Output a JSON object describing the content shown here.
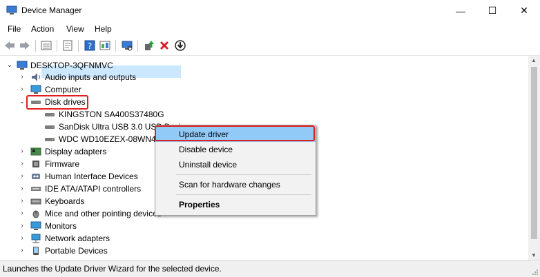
{
  "window": {
    "title": "Device Manager",
    "minimize": "—",
    "maximize": "☐",
    "close": "✕"
  },
  "menu": [
    "File",
    "Action",
    "View",
    "Help"
  ],
  "tree": {
    "root": "DESKTOP-3QFNMVC",
    "items": [
      {
        "label": "Audio inputs and outputs",
        "icon": "speaker-icon"
      },
      {
        "label": "Computer",
        "icon": "monitor-icon"
      },
      {
        "label": "Disk drives",
        "icon": "drive-icon"
      },
      {
        "label": "KINGSTON SA400S37480G",
        "icon": "drive-icon"
      },
      {
        "label": "SanDisk Ultra USB 3.0 USB Device",
        "icon": "drive-icon"
      },
      {
        "label": "WDC WD10EZEX-08WN4A0",
        "icon": "drive-icon"
      },
      {
        "label": "Display adapters",
        "icon": "display-adapter-icon"
      },
      {
        "label": "Firmware",
        "icon": "firmware-icon"
      },
      {
        "label": "Human Interface Devices",
        "icon": "hid-icon"
      },
      {
        "label": "IDE ATA/ATAPI controllers",
        "icon": "ide-icon"
      },
      {
        "label": "Keyboards",
        "icon": "keyboard-icon"
      },
      {
        "label": "Mice and other pointing devices",
        "icon": "mouse-icon"
      },
      {
        "label": "Monitors",
        "icon": "monitor-icon"
      },
      {
        "label": "Network adapters",
        "icon": "network-icon"
      },
      {
        "label": "Portable Devices",
        "icon": "portable-icon"
      }
    ]
  },
  "context_menu": {
    "update": "Update driver",
    "disable": "Disable device",
    "uninstall": "Uninstall device",
    "scan": "Scan for hardware changes",
    "properties": "Properties"
  },
  "status": "Launches the Update Driver Wizard for the selected device.",
  "colors": {
    "highlight": "#e0201e",
    "selection": "#cce8ff",
    "menu_hover": "#91c9f7"
  }
}
